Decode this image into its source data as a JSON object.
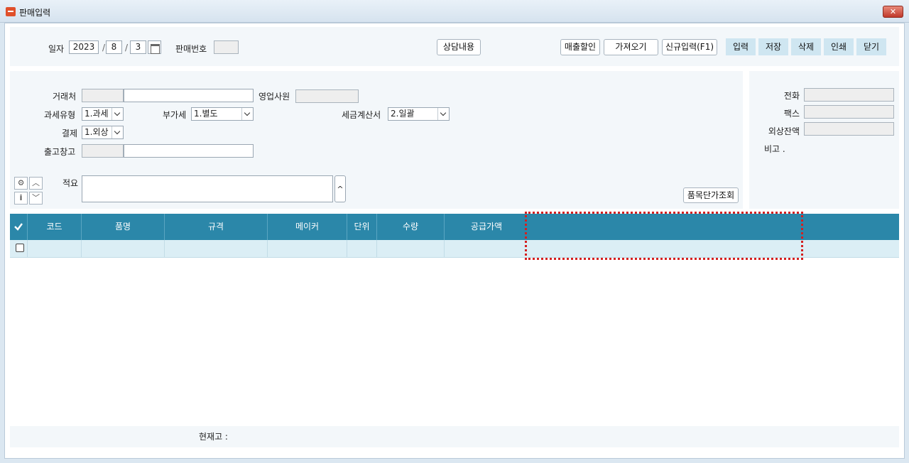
{
  "window": {
    "title": "판매입력",
    "close_label": "✕"
  },
  "header": {
    "date_label": "일자",
    "date_year": "2023",
    "date_month": "8",
    "date_day": "3",
    "date_sep": "/",
    "sale_no_label": "판매번호",
    "sale_no_value": "",
    "consult_button": "상담내용",
    "buttons": [
      "매출할인",
      "가져오기",
      "신규입력(F1)"
    ],
    "toolbar": [
      "입력",
      "저장",
      "삭제",
      "인쇄",
      "닫기"
    ]
  },
  "form": {
    "customer_label": "거래처",
    "sales_rep_label": "영업사원",
    "tax_type_label": "과세유형",
    "tax_type_value": "1.과세",
    "vat_label": "부가세",
    "vat_value": "1.별도",
    "invoice_label": "세금계산서",
    "invoice_value": "2.일괄",
    "payment_label": "결제",
    "payment_value": "1.외상",
    "warehouse_label": "출고창고",
    "memo_label": "적요",
    "expand_label": "^",
    "price_lookup_button": "품목단가조회"
  },
  "side": {
    "phone_label": "전화",
    "fax_label": "팩스",
    "balance_label": "외상잔액",
    "note_label": "비고 ."
  },
  "grid": {
    "columns": [
      "코드",
      "품명",
      "규격",
      "메이커",
      "단위",
      "수량",
      "공급가액"
    ],
    "rows": [
      {
        "checked": false,
        "cells": [
          "",
          "",
          "",
          "",
          "",
          "",
          ""
        ]
      }
    ]
  },
  "footer": {
    "stock_label": "현재고 :"
  },
  "colors": {
    "header_bg": "#2b87a9",
    "row_bg": "#dbeef5",
    "highlight": "#d42020",
    "toolbar_btn": "#cfe6f1"
  }
}
